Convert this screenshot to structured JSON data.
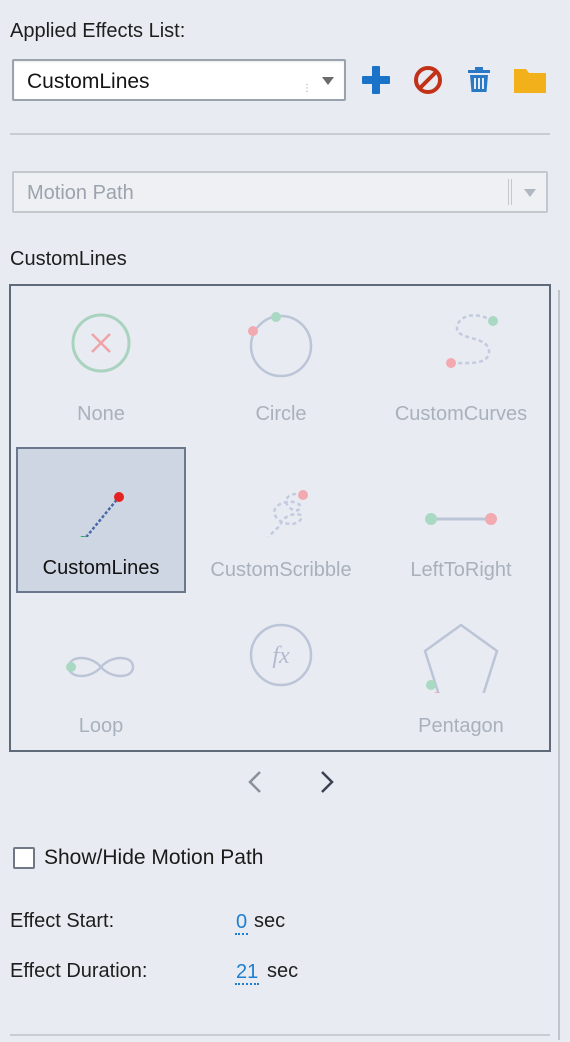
{
  "applied_effects": {
    "label": "Applied Effects List:",
    "selected": "CustomLines"
  },
  "toolbar": {
    "add_icon": "plus-icon",
    "remove_icon": "no-entry-icon",
    "delete_icon": "trash-icon",
    "folder_icon": "folder-icon",
    "colors": {
      "add": "#1a72c9",
      "remove": "#c23219",
      "delete": "#2a79c5",
      "folder": "#f2b01a"
    }
  },
  "category": {
    "selected": "Motion Path"
  },
  "effects_group": {
    "title": "CustomLines",
    "items": [
      {
        "label": "None",
        "icon": "none-icon",
        "selected": false
      },
      {
        "label": "Circle",
        "icon": "circle-path-icon",
        "selected": false
      },
      {
        "label": "CustomCurves",
        "icon": "custom-curves-icon",
        "selected": false
      },
      {
        "label": "CustomLines",
        "icon": "custom-lines-icon",
        "selected": true
      },
      {
        "label": "CustomScribble",
        "icon": "custom-scribble-icon",
        "selected": false
      },
      {
        "label": "LeftToRight",
        "icon": "left-to-right-icon",
        "selected": false
      },
      {
        "label": "Loop",
        "icon": "loop-icon",
        "selected": false
      },
      {
        "label": "",
        "icon": "fx-icon",
        "selected": false
      },
      {
        "label": "Pentagon",
        "icon": "pentagon-icon",
        "selected": false
      }
    ]
  },
  "pager": {
    "prev_icon": "chevron-left-icon",
    "next_icon": "chevron-right-icon"
  },
  "show_hide": {
    "label": "Show/Hide Motion Path",
    "checked": false
  },
  "timing": {
    "start_label": "Effect Start:",
    "start_value": "0",
    "start_unit": "sec",
    "duration_label": "Effect Duration:",
    "duration_value": "21",
    "duration_unit": "sec"
  }
}
